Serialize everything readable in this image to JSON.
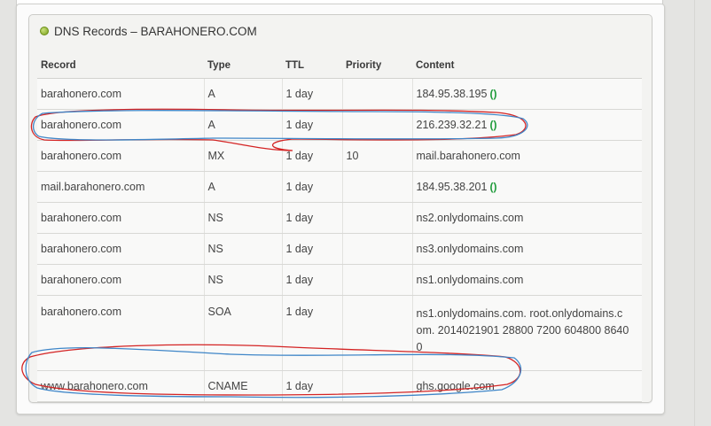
{
  "panel": {
    "title": "DNS Records – BARAHONERO.COM"
  },
  "columns": [
    "Record",
    "Type",
    "TTL",
    "Priority",
    "Content"
  ],
  "rows": [
    {
      "record": "barahonero.com",
      "type": "A",
      "ttl": "1 day",
      "priority": "",
      "content": "184.95.38.195",
      "icon": "()"
    },
    {
      "record": "barahonero.com",
      "type": "A",
      "ttl": "1 day",
      "priority": "",
      "content": "216.239.32.21",
      "icon": "()"
    },
    {
      "record": "barahonero.com",
      "type": "MX",
      "ttl": "1 day",
      "priority": "10",
      "content": "mail.barahonero.com",
      "icon": ""
    },
    {
      "record": "mail.barahonero.com",
      "type": "A",
      "ttl": "1 day",
      "priority": "",
      "content": "184.95.38.201",
      "icon": "()"
    },
    {
      "record": "barahonero.com",
      "type": "NS",
      "ttl": "1 day",
      "priority": "",
      "content": "ns2.onlydomains.com",
      "icon": ""
    },
    {
      "record": "barahonero.com",
      "type": "NS",
      "ttl": "1 day",
      "priority": "",
      "content": "ns3.onlydomains.com",
      "icon": ""
    },
    {
      "record": "barahonero.com",
      "type": "NS",
      "ttl": "1 day",
      "priority": "",
      "content": "ns1.onlydomains.com",
      "icon": ""
    },
    {
      "record": "barahonero.com",
      "type": "SOA",
      "ttl": "1 day",
      "priority": "",
      "content_lines": [
        "ns1.onlydomains.com. root.onlydomains.c",
        "om. 2014021901 28800 7200 604800 8640",
        "0"
      ],
      "icon": ""
    },
    {
      "record": "www.barahonero.com",
      "type": "CNAME",
      "ttl": "1 day",
      "priority": "",
      "content": "ghs.google.com",
      "icon": ""
    }
  ],
  "colors": {
    "annotation_red": "#d42424",
    "annotation_blue": "#3f86c8",
    "status_dot": "#8ab02a",
    "ip_icon": "#1e9b3a"
  }
}
